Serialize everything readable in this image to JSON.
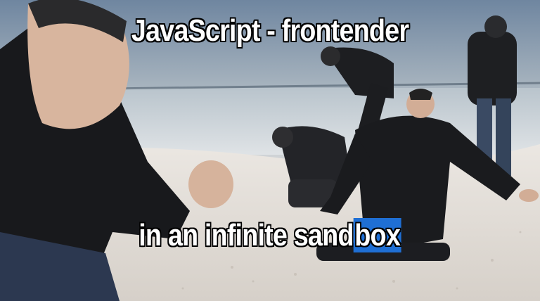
{
  "meme": {
    "top_text": "JavaScript - frontender",
    "bottom_text_plain": "in an infinite sand",
    "bottom_text_highlight": "box"
  },
  "colors": {
    "sky": "#7f93a6",
    "sea": "#c9d2d8",
    "sand": "#e3e0dc",
    "jacket": "#1b1c1f",
    "skin": "#d9b7a0",
    "highlight": "#1f6fd4",
    "caption_text": "#ffffff",
    "caption_outline": "#000000"
  }
}
